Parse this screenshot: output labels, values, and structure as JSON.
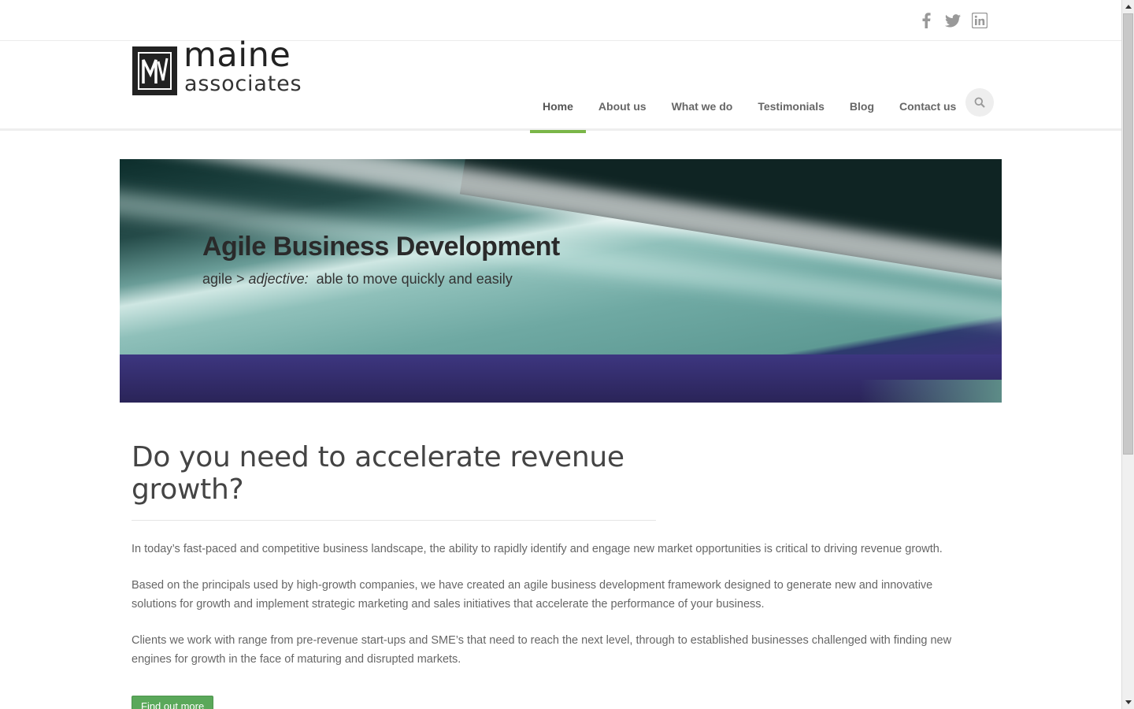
{
  "topbar": {
    "social": [
      {
        "icon": "facebook-icon"
      },
      {
        "icon": "twitter-icon"
      },
      {
        "icon": "linkedin-icon"
      }
    ]
  },
  "logo": {
    "word1": "maine",
    "word2": "associates"
  },
  "nav": {
    "items": [
      {
        "label": "Home",
        "active": true
      },
      {
        "label": "About us"
      },
      {
        "label": "What we do"
      },
      {
        "label": "Testimonials"
      },
      {
        "label": "Blog"
      },
      {
        "label": "Contact us"
      }
    ],
    "search_icon": "search-icon"
  },
  "hero": {
    "title": "Agile Business Development",
    "sub_prefix": "agile > ",
    "sub_em": "adjective:",
    "sub_suffix": "  able to move quickly and easily"
  },
  "main": {
    "headline": "Do you need to accelerate revenue growth?",
    "paragraphs": [
      "In today’s fast-paced and competitive business landscape, the ability to rapidly identify and engage new market opportunities is critical to driving revenue growth.",
      "Based on the principals used by high-growth companies, we have created an agile business development framework designed to generate new and innovative solutions for growth and implement strategic marketing and sales initiatives that accelerate the performance of your business.",
      "Clients we work with range from pre-revenue start-ups and SME’s that need to reach the next level, through to established businesses challenged with finding new engines for growth in the face of maturing and disrupted markets."
    ],
    "cta_label": "Find out more"
  },
  "colors": {
    "accent": "#7ab648",
    "button": "#5aa85a"
  }
}
